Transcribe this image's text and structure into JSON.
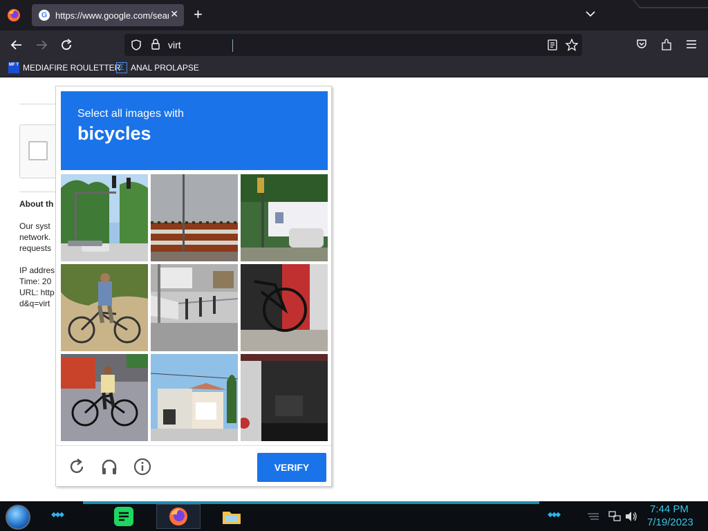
{
  "browser": {
    "tab": {
      "title": "https://www.google.com/search?q=virt",
      "close_label": "✕"
    },
    "new_tab_label": "+",
    "url_text": "virt",
    "bookmarks": [
      {
        "icon_text": "MF T",
        "label": "MEDIAFIRE ROULETTER"
      },
      {
        "label": "ANAL PROLAPSE"
      }
    ]
  },
  "page": {
    "about_heading": "About th",
    "info_lines": [
      "Our syst",
      "network.",
      "requests",
      "",
      "IP addres",
      "Time: 20",
      "URL: http",
      "d&q=virt"
    ]
  },
  "captcha": {
    "instruction": "Select all images with",
    "target": "bicycles",
    "verify_label": "VERIFY",
    "tiles": [
      {
        "icon": "street-traffic-light"
      },
      {
        "icon": "building-pole"
      },
      {
        "icon": "traffic-light-car"
      },
      {
        "icon": "person-bicycle"
      },
      {
        "icon": "sidewalk"
      },
      {
        "icon": "bicycle-wall"
      },
      {
        "icon": "person-bicycle-street"
      },
      {
        "icon": "houses"
      },
      {
        "icon": "garage"
      }
    ],
    "accent_color": "#1a73e8"
  },
  "taskbar": {
    "time": "7:44 PM",
    "date": "7/19/2023",
    "accent_color": "#36c6e6"
  }
}
